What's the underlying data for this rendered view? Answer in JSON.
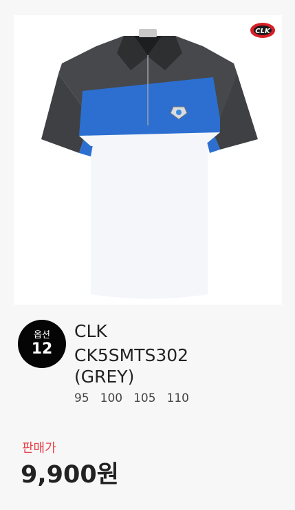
{
  "brand": {
    "logo_text": "CLK",
    "name": "CLK"
  },
  "option": {
    "label": "옵션",
    "count": "12"
  },
  "product": {
    "model_line1": "CK5SMTS302",
    "model_line2": "(GREY)",
    "sizes": [
      "95",
      "100",
      "105",
      "110"
    ]
  },
  "price": {
    "label": "판매가",
    "value": "9,900원"
  },
  "colors": {
    "price_label": "#e8424a",
    "shirt_grey": "#4a4b4d",
    "shirt_blue": "#2d6fd0"
  }
}
